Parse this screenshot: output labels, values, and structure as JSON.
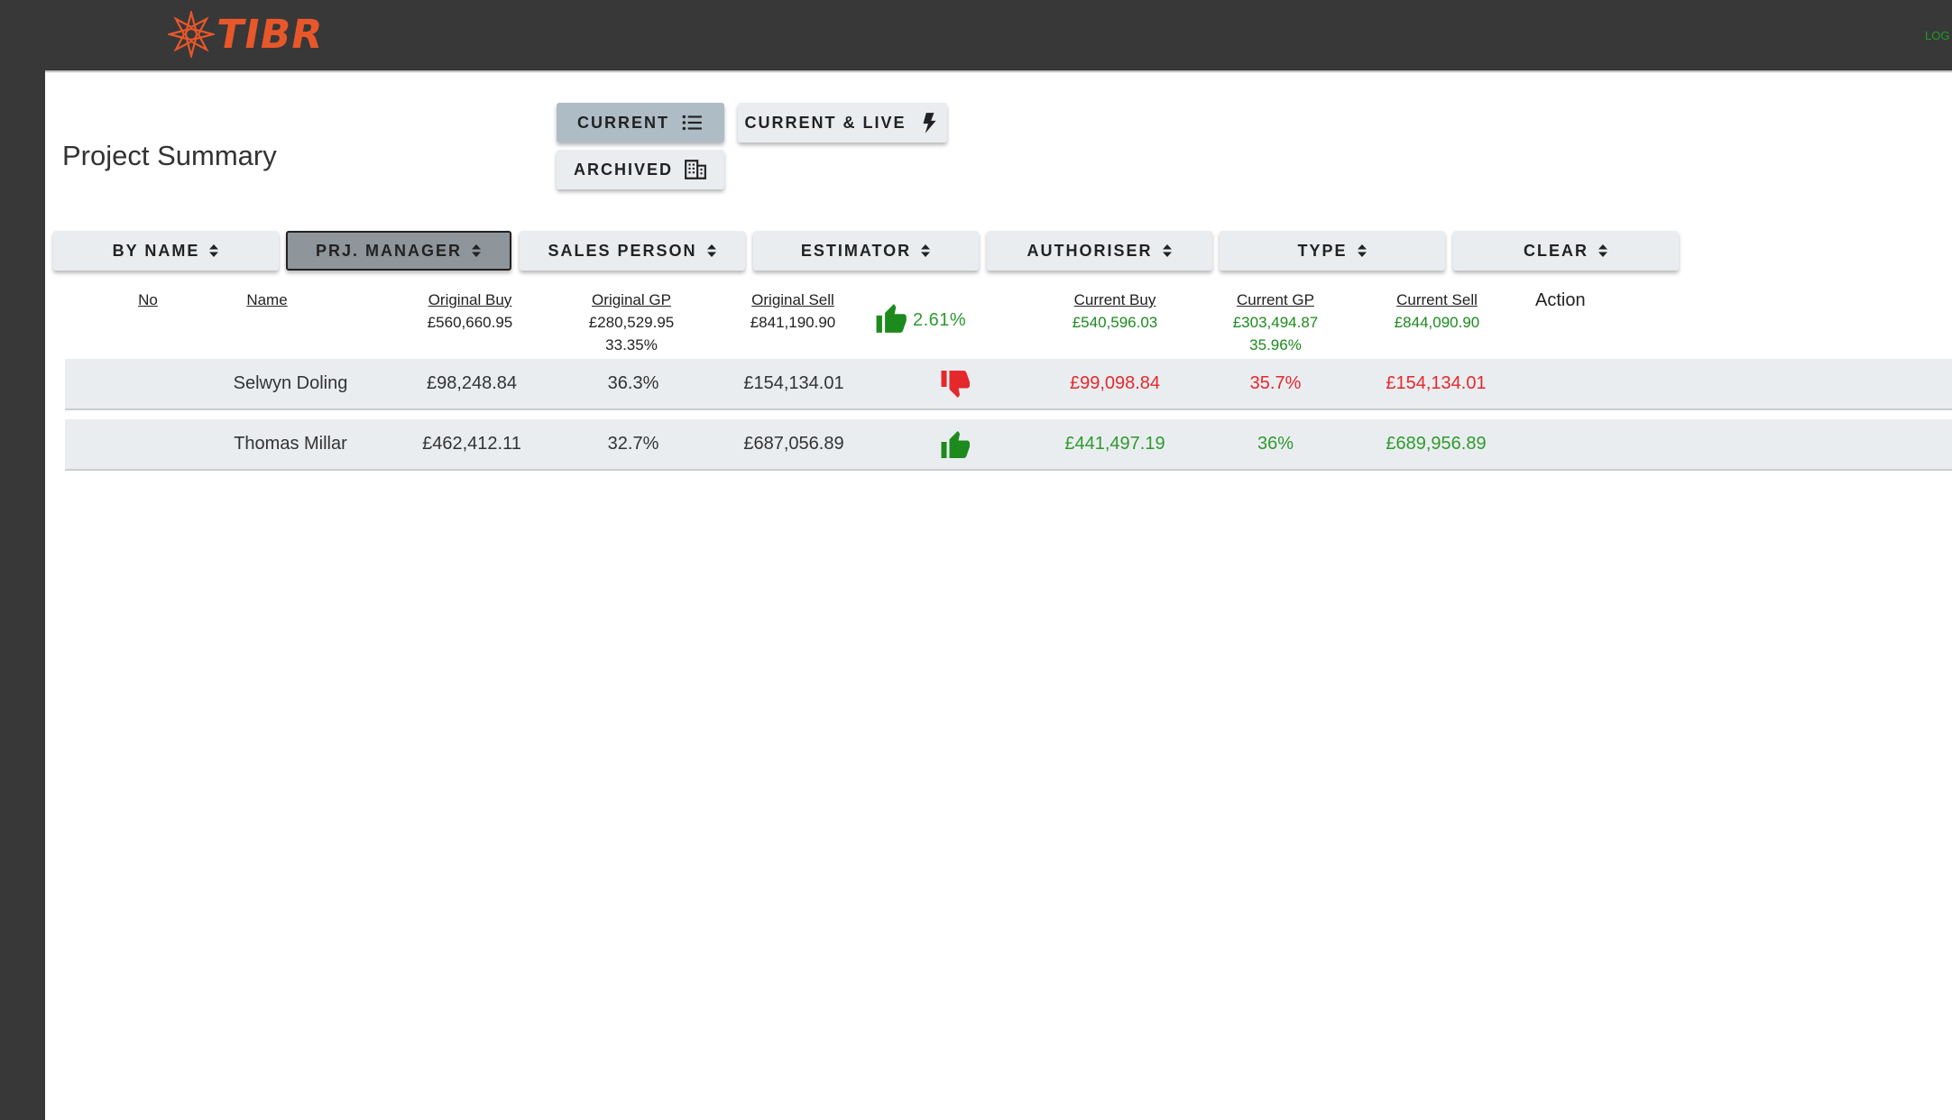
{
  "app": {
    "brand": "TIBR",
    "login_text": "LOG"
  },
  "page": {
    "title": "Project Summary"
  },
  "view_buttons": {
    "current": "CURRENT",
    "current_live": "CURRENT & LIVE",
    "archived": "ARCHIVED"
  },
  "filters": [
    {
      "label": "BY NAME",
      "active": false
    },
    {
      "label": "PRJ. MANAGER",
      "active": true
    },
    {
      "label": "SALES PERSON",
      "active": false
    },
    {
      "label": "ESTIMATOR",
      "active": false
    },
    {
      "label": "AUTHORISER",
      "active": false
    },
    {
      "label": "TYPE",
      "active": false
    },
    {
      "label": "CLEAR",
      "active": false
    }
  ],
  "columns": {
    "no": "No",
    "name": "Name",
    "original_buy": "Original Buy",
    "original_gp": "Original GP",
    "original_sell": "Original Sell",
    "current_buy": "Current Buy",
    "current_gp": "Current GP",
    "current_sell": "Current Sell",
    "action": "Action"
  },
  "totals": {
    "original_buy": "£560,660.95",
    "original_gp": "£280,529.95",
    "original_gp_pct": "33.35%",
    "original_sell": "£841,190.90",
    "variance_pct": "2.61%",
    "variance_icon": "thumbs-up-icon",
    "current_buy": "£540,596.03",
    "current_gp": "£303,494.87",
    "current_gp_pct": "35.96%",
    "current_sell": "£844,090.90"
  },
  "rows": [
    {
      "name": "Selwyn Doling",
      "original_buy": "£98,248.84",
      "original_gp": "36.3%",
      "original_sell": "£154,134.01",
      "status_icon": "thumbs-down-icon",
      "current_buy": "£99,098.84",
      "current_gp": "35.7%",
      "current_sell": "£154,134.01",
      "status": "red"
    },
    {
      "name": "Thomas Millar",
      "original_buy": "£462,412.11",
      "original_gp": "32.7%",
      "original_sell": "£687,056.89",
      "status_icon": "thumbs-up-icon",
      "current_buy": "£441,497.19",
      "current_gp": "36%",
      "current_sell": "£689,956.89",
      "status": "green"
    }
  ],
  "colors": {
    "topbar": "#383838",
    "brand": "#e8572a",
    "positive": "#2e9a2e",
    "negative": "#e5282c",
    "active_view": "#aebcc6",
    "active_filter": "#8e969c"
  }
}
